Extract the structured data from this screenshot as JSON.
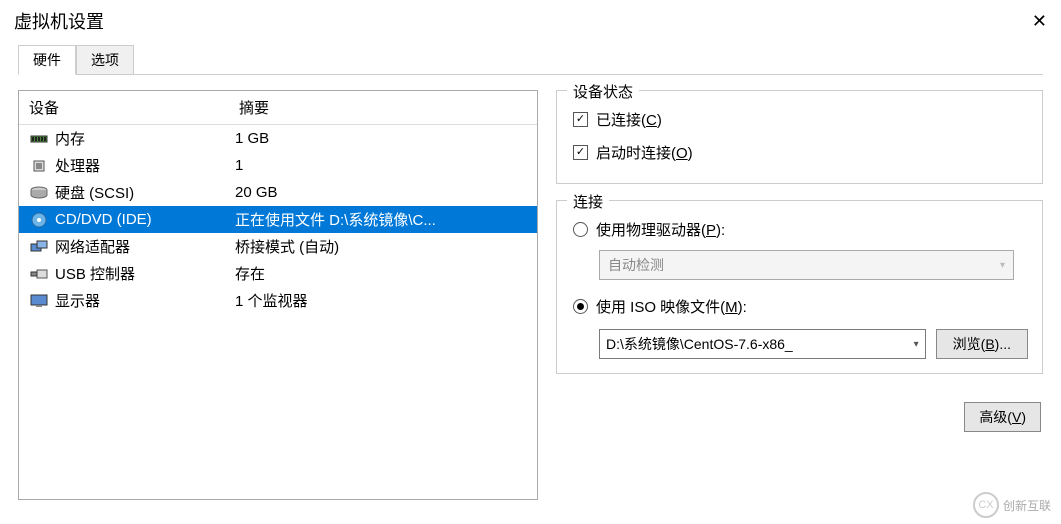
{
  "window": {
    "title": "虚拟机设置",
    "close_symbol": "✕"
  },
  "tabs": {
    "hardware": "硬件",
    "options": "选项"
  },
  "device_list": {
    "header_device": "设备",
    "header_summary": "摘要",
    "rows": [
      {
        "icon": "memory-icon",
        "label": "内存",
        "summary": "1 GB"
      },
      {
        "icon": "cpu-icon",
        "label": "处理器",
        "summary": "1"
      },
      {
        "icon": "disk-icon",
        "label": "硬盘 (SCSI)",
        "summary": "20 GB"
      },
      {
        "icon": "cd-icon",
        "label": "CD/DVD (IDE)",
        "summary": "正在使用文件 D:\\系统镜像\\C..."
      },
      {
        "icon": "net-icon",
        "label": "网络适配器",
        "summary": "桥接模式 (自动)"
      },
      {
        "icon": "usb-icon",
        "label": "USB 控制器",
        "summary": "存在"
      },
      {
        "icon": "display-icon",
        "label": "显示器",
        "summary": "1 个监视器"
      }
    ],
    "selected_index": 3
  },
  "device_status": {
    "legend": "设备状态",
    "connected_label_pre": "已连接(",
    "connected_key": "C",
    "connected_label_post": ")",
    "startup_label_pre": "启动时连接(",
    "startup_key": "O",
    "startup_label_post": ")",
    "connected_checked": true,
    "startup_checked": true
  },
  "connection": {
    "legend": "连接",
    "physical_label_pre": "使用物理驱动器(",
    "physical_key": "P",
    "physical_label_post": "):",
    "physical_dropdown_value": "自动检测",
    "iso_label_pre": "使用 ISO 映像文件(",
    "iso_key": "M",
    "iso_label_post": "):",
    "iso_path": "D:\\系统镜像\\CentOS-7.6-x86_",
    "browse_label_pre": "浏览(",
    "browse_key": "B",
    "browse_label_post": ")...",
    "selected_option": "iso"
  },
  "advanced_button": {
    "label_pre": "高级(",
    "key": "V",
    "label_post": ")"
  },
  "watermark": {
    "icon_text": "CX",
    "text": "创新互联"
  }
}
